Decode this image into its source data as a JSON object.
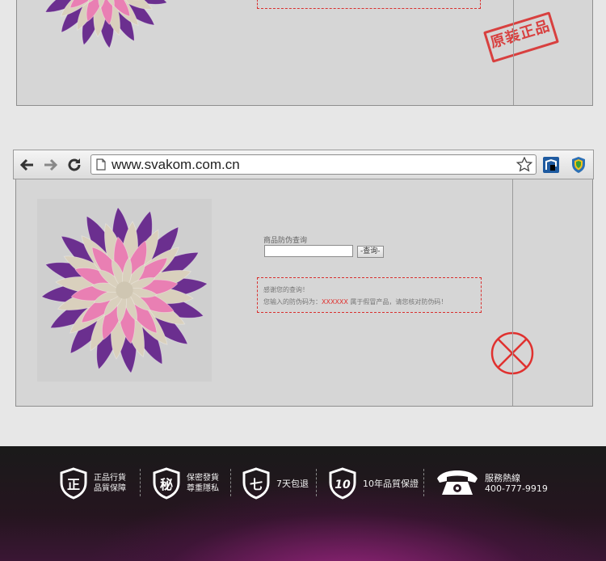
{
  "top_panel": {
    "stamp_text": "原装正品"
  },
  "browser": {
    "url": "www.svakom.com.cn"
  },
  "query": {
    "label": "商品防伪查询",
    "input_value": "",
    "button_label": "-查询-"
  },
  "result": {
    "line1": "感谢您的查询！",
    "line2_prefix": "您输入的防伪码为：",
    "code": "XXXXXX",
    "line2_suffix": " 属于假冒产品，请您核对防伪码！"
  },
  "footer": {
    "items": [
      {
        "icon": "正",
        "line1": "正品行貨",
        "line2": "品質保障"
      },
      {
        "icon": "秘",
        "line1": "保密發貨",
        "line2": "尊重隱私"
      },
      {
        "icon": "七",
        "line1": "7天包退",
        "line2": ""
      },
      {
        "icon": "10",
        "line1": "10年品質保證",
        "line2": ""
      }
    ],
    "hotline_label": "服務熱線",
    "hotline_number": "400-777-9919"
  },
  "colors": {
    "stamp_red": "#d9302f",
    "petal_purple": "#6b2f8f",
    "petal_pink": "#e97fb3",
    "petal_beige": "#d9d0bd"
  }
}
